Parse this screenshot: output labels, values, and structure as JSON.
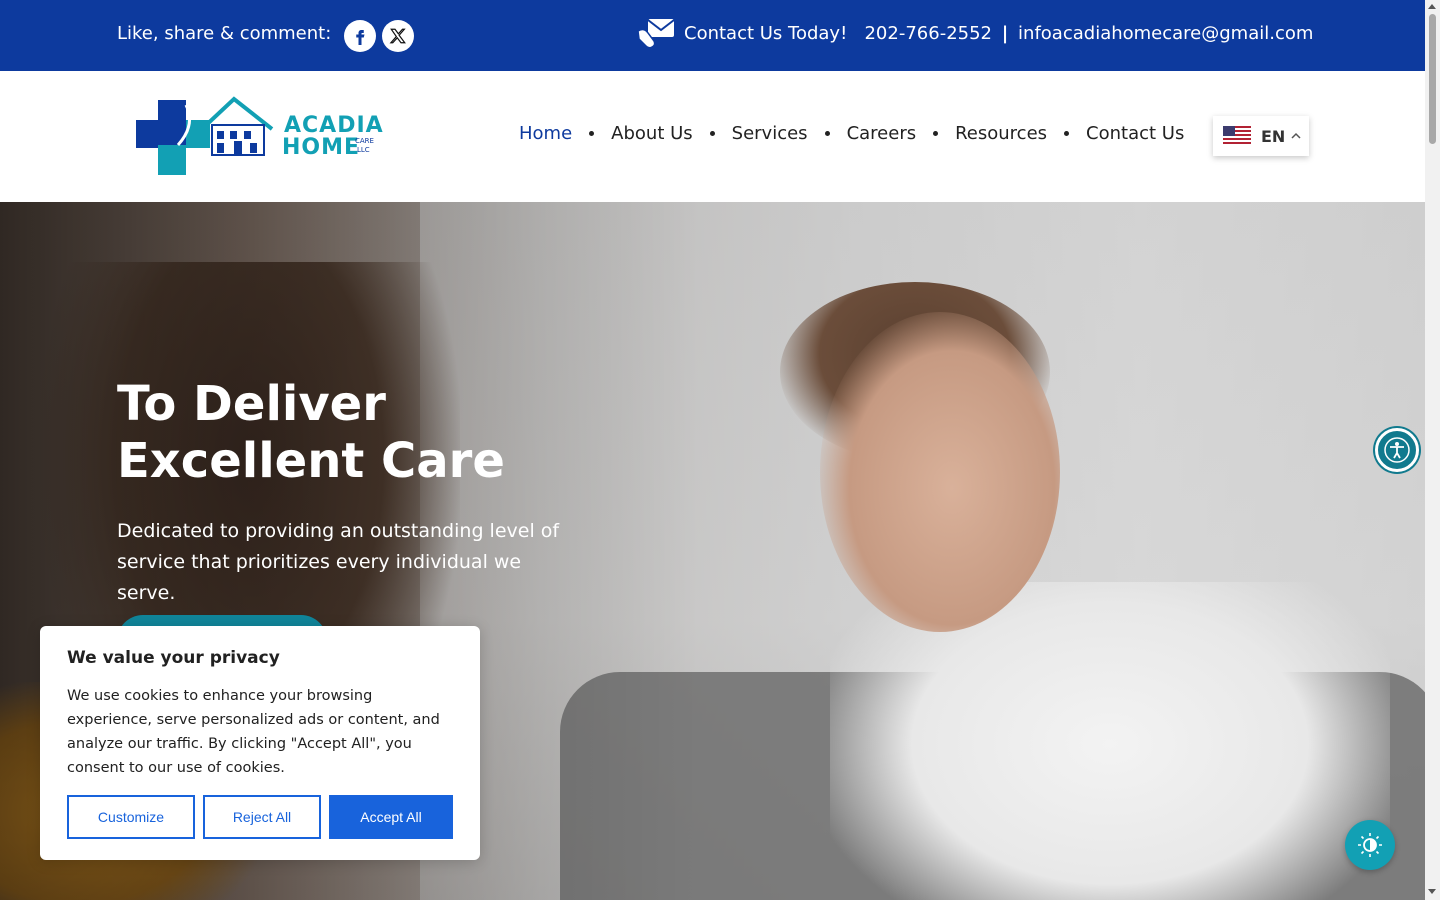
{
  "topbar": {
    "share_label": "Like, share & comment:",
    "social": [
      "facebook-icon",
      "x-icon"
    ],
    "contact_label": "Contact Us Today!",
    "phone": "202-766-2552",
    "separator": "|",
    "email": "infoacadiahomecare@gmail.com"
  },
  "logo": {
    "line1": "ACADIA",
    "line2": "HOME",
    "care": "CARE",
    "llc": "LLC"
  },
  "nav": {
    "items": [
      "Home",
      "About Us",
      "Services",
      "Careers",
      "Resources",
      "Contact Us"
    ],
    "active": "Home"
  },
  "language": {
    "code": "EN"
  },
  "hero": {
    "title_line1": "To Deliver",
    "title_line2": "Excellent Care",
    "subtitle": "Dedicated to providing an outstanding level of service that prioritizes every individual we serve."
  },
  "cookie": {
    "title": "We value your privacy",
    "body": "We use cookies to enhance your browsing experience, serve personalized ads or content, and analyze our traffic. By clicking \"Accept All\", you consent to our use of cookies.",
    "customize": "Customize",
    "reject": "Reject All",
    "accept": "Accept All"
  },
  "colors": {
    "brand_blue": "#0d3a9e",
    "teal": "#10859a",
    "cookie_blue": "#1863dc"
  }
}
